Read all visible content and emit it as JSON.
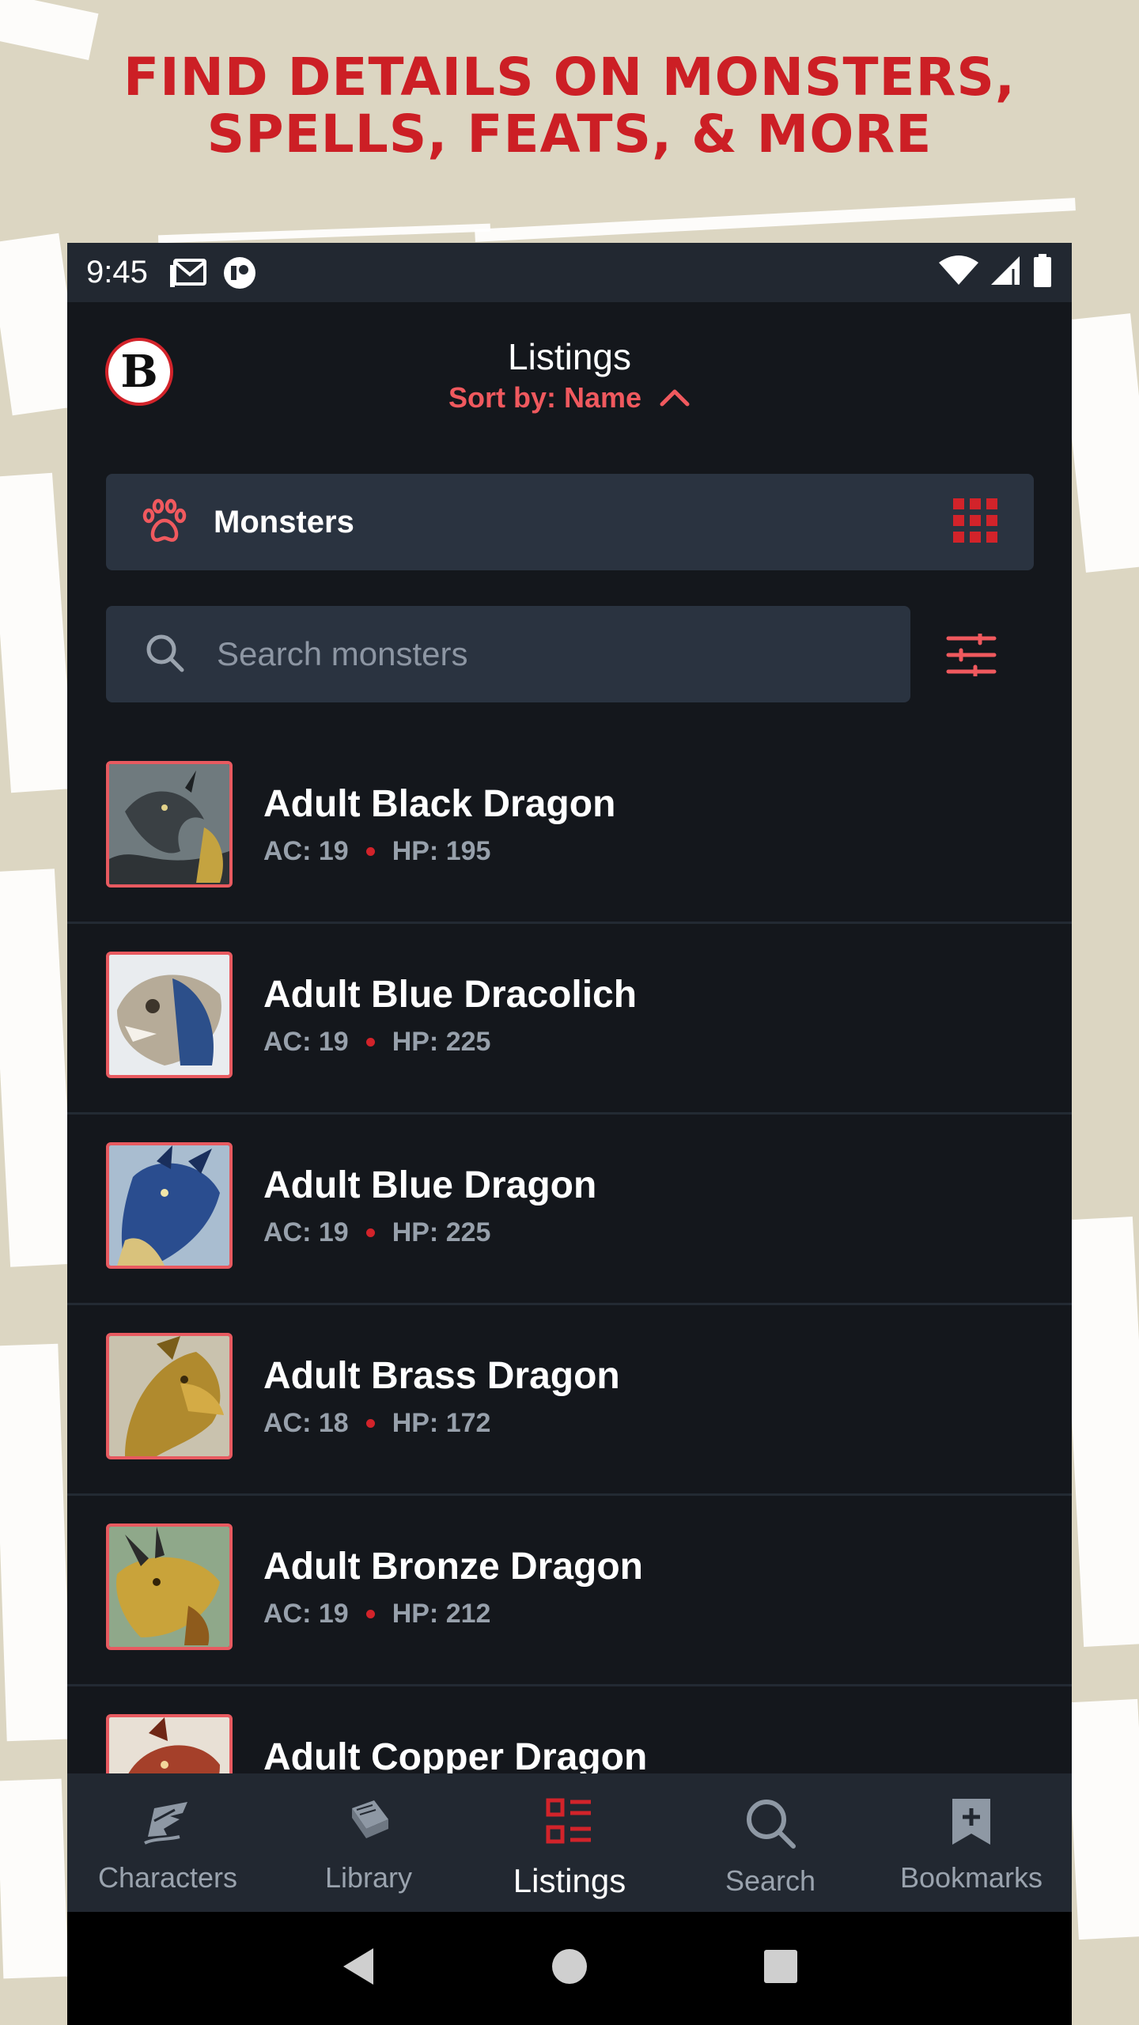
{
  "headline": {
    "line1": "FIND DETAILS ON MONSTERS,",
    "line2": "SPELLS, FEATS, & MORE"
  },
  "statusbar": {
    "time": "9:45",
    "icons": [
      "gmail-icon",
      "app-notification-icon",
      "wifi-icon",
      "cellular-signal-icon",
      "battery-icon"
    ]
  },
  "appbar": {
    "logo_letter": "B",
    "title": "Listings",
    "sort_label": "Sort by: Name"
  },
  "category": {
    "icon": "paw-icon",
    "label": "Monsters"
  },
  "search": {
    "placeholder": "Search monsters"
  },
  "monsters": [
    {
      "name": "Adult Black Dragon",
      "ac": "AC: 19",
      "hp": "HP: 195"
    },
    {
      "name": "Adult Blue Dracolich",
      "ac": "AC: 19",
      "hp": "HP: 225"
    },
    {
      "name": "Adult Blue Dragon",
      "ac": "AC: 19",
      "hp": "HP: 225"
    },
    {
      "name": "Adult Brass Dragon",
      "ac": "AC: 18",
      "hp": "HP: 172"
    },
    {
      "name": "Adult Bronze Dragon",
      "ac": "AC: 19",
      "hp": "HP: 212"
    },
    {
      "name": "Adult Copper Dragon",
      "ac": "",
      "hp": ""
    }
  ],
  "bottomnav": [
    {
      "label": "Characters",
      "icon": "quill-icon",
      "active": false
    },
    {
      "label": "Library",
      "icon": "book-icon",
      "active": false
    },
    {
      "label": "Listings",
      "icon": "list-icon",
      "active": true
    },
    {
      "label": "Search",
      "icon": "search-icon",
      "active": false
    },
    {
      "label": "Bookmarks",
      "icon": "bookmark-icon",
      "active": false
    }
  ],
  "colors": {
    "brand_red": "#cc1f25",
    "accent_red": "#f0595e",
    "background": "#14171c",
    "panel": "#2a3340",
    "page_bg": "#dcd6c2"
  }
}
